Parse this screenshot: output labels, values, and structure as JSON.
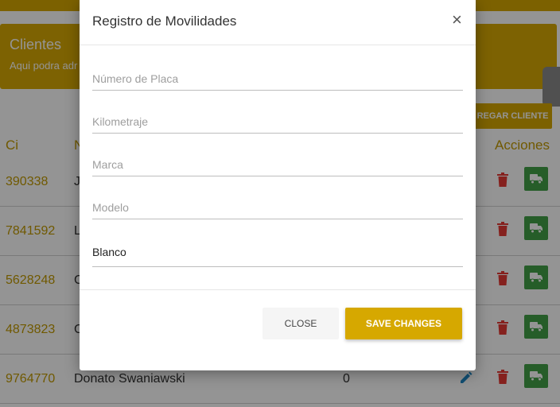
{
  "page": {
    "banner_title": "Clientes",
    "banner_subtitle": "Aqui podra adr",
    "add_button_label": "REGAR CLIENTE",
    "table_headers": {
      "ci": "Ci",
      "name": "N",
      "actions": "Acciones"
    },
    "rows": [
      {
        "ci": "390338",
        "name": "J",
        "num": ""
      },
      {
        "ci": "7841592",
        "name": "L",
        "num": ""
      },
      {
        "ci": "5628248",
        "name": "C",
        "num": ""
      },
      {
        "ci": "4873823",
        "name": "C",
        "num": ""
      },
      {
        "ci": "9764770",
        "name": "Donato Swaniawski",
        "num": "0"
      }
    ]
  },
  "modal": {
    "title": "Registro de Movilidades",
    "close_glyph": "×",
    "fields": [
      {
        "placeholder": "Número de Placa",
        "value": ""
      },
      {
        "placeholder": "Kilometraje",
        "value": ""
      },
      {
        "placeholder": "Marca",
        "value": ""
      },
      {
        "placeholder": "Modelo",
        "value": ""
      },
      {
        "placeholder": "",
        "value": "Blanco"
      }
    ],
    "close_button_label": "CLOSE",
    "save_button_label": "SAVE CHANGES"
  },
  "colors": {
    "accent": "#d6a800",
    "success": "#43a047",
    "danger": "#e53935",
    "edit": "#1e88c7"
  },
  "icons": [
    "close-icon",
    "edit-icon",
    "trash-icon",
    "car-icon"
  ]
}
